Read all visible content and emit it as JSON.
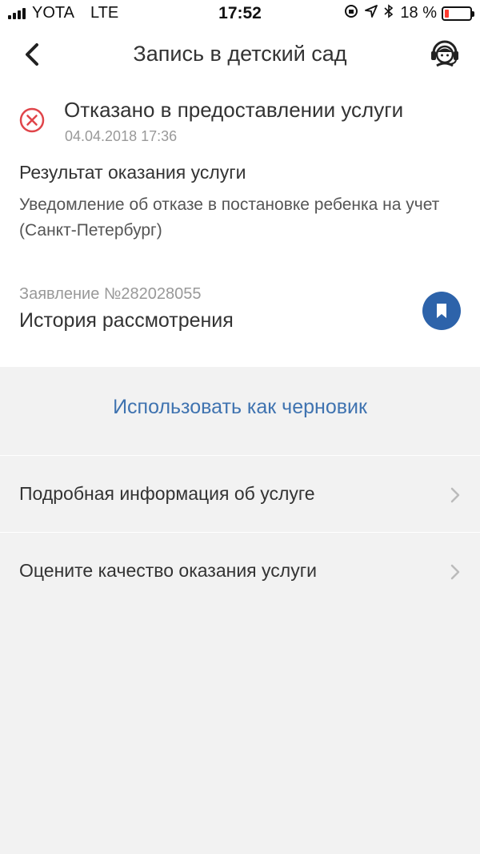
{
  "status_bar": {
    "carrier": "YOTA",
    "network": "LTE",
    "time": "17:52",
    "battery_percent": "18 %",
    "battery_level": 0.18
  },
  "header": {
    "title": "Запись в детский сад"
  },
  "service_status": {
    "title": "Отказано в предоставлении услуги",
    "date": "04.04.2018 17:36"
  },
  "result": {
    "heading": "Результат оказания услуги",
    "text": "Уведомление об отказе в постановке ребенка на учет (Санкт-Петербург)"
  },
  "application": {
    "number": "Заявление №282028055",
    "history_label": "История рассмотрения"
  },
  "actions": {
    "draft_label": "Использовать как черновик"
  },
  "menu": {
    "items": [
      {
        "label": "Подробная информация об услуге"
      },
      {
        "label": "Оцените качество оказания услуги"
      }
    ]
  },
  "colors": {
    "accent": "#2d63aa",
    "link": "#3f73b0",
    "error": "#e0454a",
    "battery_low": "#ff3b30"
  }
}
